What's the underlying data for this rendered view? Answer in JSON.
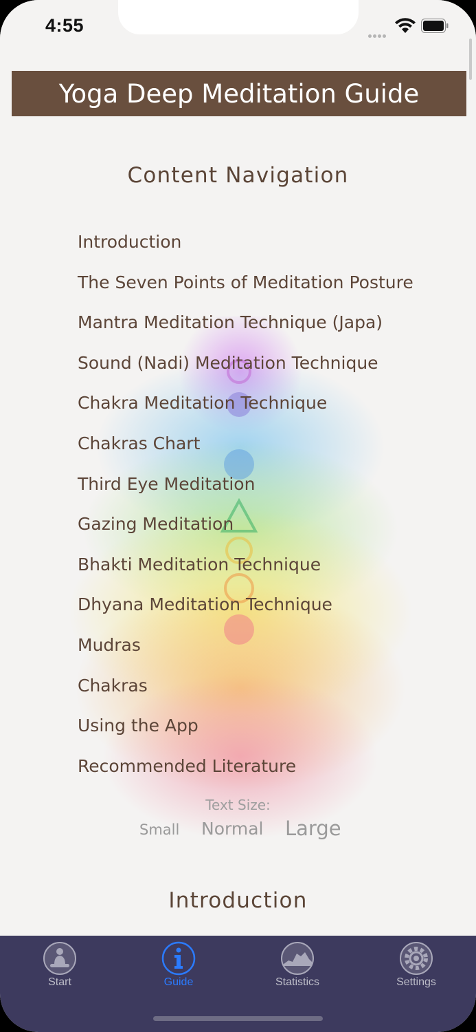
{
  "status_bar": {
    "time": "4:55"
  },
  "header": {
    "title": "Yoga Deep Meditation Guide"
  },
  "content": {
    "nav_title": "Content Navigation",
    "nav_items": [
      "Introduction",
      "The Seven Points of Meditation Posture",
      "Mantra Meditation Technique (Japa)",
      "Sound (Nadi) Meditation Technique",
      "Chakra Meditation Technique",
      "Chakras Chart",
      "Third Eye Meditation",
      "Gazing Meditation",
      "Bhakti Meditation Technique",
      "Dhyana Meditation Technique",
      "Mudras",
      "Chakras",
      "Using the App",
      "Recommended Literature"
    ],
    "text_size": {
      "label": "Text Size:",
      "small": "Small",
      "normal": "Normal",
      "large": "Large"
    },
    "section_heading": "Introduction"
  },
  "tabbar": {
    "tabs": [
      {
        "label": "Start",
        "icon": "meditation-icon"
      },
      {
        "label": "Guide",
        "icon": "info-icon",
        "active": true
      },
      {
        "label": "Statistics",
        "icon": "statistics-icon"
      },
      {
        "label": "Settings",
        "icon": "gear-icon"
      }
    ]
  },
  "colors": {
    "header_bg": "#694f3e",
    "text_brown": "#5c4538",
    "tabbar_bg": "#3d3a5e",
    "active_tab": "#2b7bff"
  }
}
